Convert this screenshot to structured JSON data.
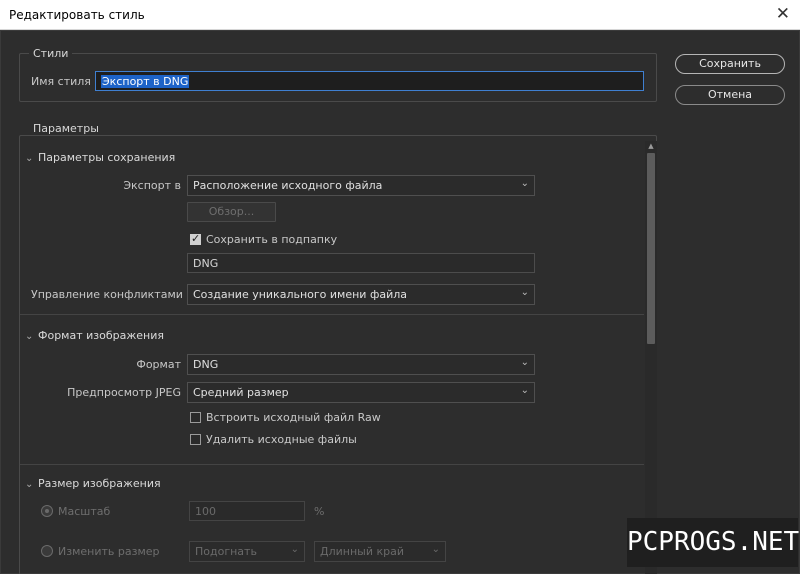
{
  "window": {
    "title": "Редактировать стиль",
    "close_icon": "close-icon"
  },
  "styles": {
    "legend": "Стили",
    "name_label": "Имя стиля",
    "name_value": "Экспорт в DNG"
  },
  "buttons": {
    "save": "Сохранить",
    "cancel": "Отмена"
  },
  "params": {
    "legend": "Параметры",
    "save_section": {
      "title": "Параметры сохранения",
      "export_label": "Экспорт в",
      "export_value": "Расположение исходного файла",
      "browse": "Обзор...",
      "subfolder_label": "Сохранить в подпапку",
      "subfolder_checked": true,
      "subfolder_value": "DNG",
      "conflict_label": "Управление конфликтами",
      "conflict_value": "Создание уникального имени файла"
    },
    "format_section": {
      "title": "Формат изображения",
      "format_label": "Формат",
      "format_value": "DNG",
      "preview_label": "Предпросмотр JPEG",
      "preview_value": "Средний размер",
      "embed_raw": "Встроить исходный файл Raw",
      "embed_raw_checked": false,
      "delete_source": "Удалить исходные файлы",
      "delete_source_checked": false
    },
    "size_section": {
      "title": "Размер изображения",
      "scale_label": "Масштаб",
      "scale_value": "100",
      "scale_unit": "%",
      "resize_label": "Изменить размер",
      "fit_value": "Подогнать",
      "edge_value": "Длинный край"
    }
  },
  "watermark": "PCPROGS.NET",
  "colors": {
    "background": "#2d2d2d",
    "accent": "#1d63c8",
    "text": "#cfcfcf"
  }
}
